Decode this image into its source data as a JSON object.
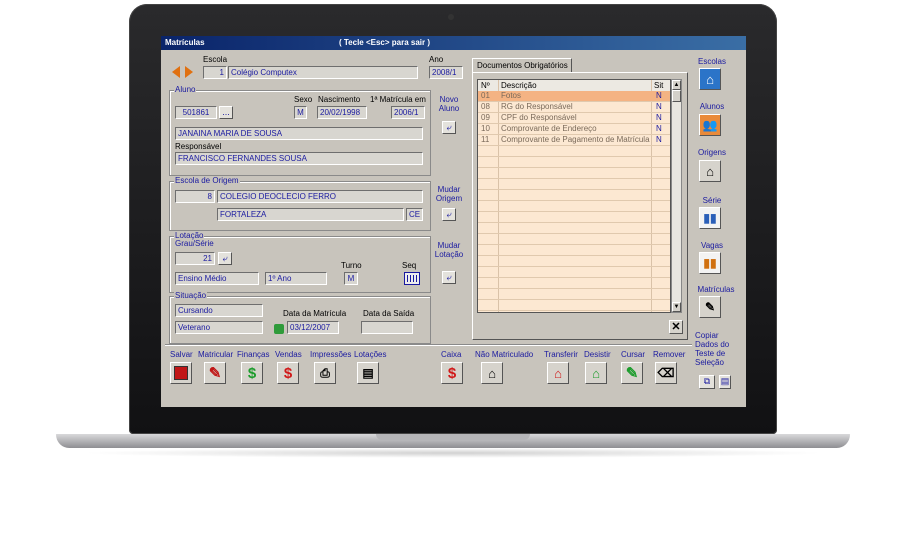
{
  "window": {
    "title": "Matrículas",
    "hint": "( Tecle <Esc> para sair )"
  },
  "escola": {
    "label": "Escola",
    "code": "1",
    "name": "Colégio Computex",
    "ano_label": "Ano",
    "ano": "2008/1"
  },
  "aluno": {
    "group": "Aluno",
    "code": "501861",
    "browse": "...",
    "sexo_label": "Sexo",
    "sexo": "M",
    "nascimento_label": "Nascimento",
    "nascimento": "20/02/1998",
    "primeira_label": "1ª Matrícula em",
    "primeira": "2006/1",
    "nome": "JANAINA MARIA DE SOUSA",
    "responsavel_label": "Responsável",
    "responsavel": "FRANCISCO FERNANDES SOUSA",
    "novo_label": "Novo Aluno"
  },
  "origem": {
    "group": "Escola de Origem",
    "code": "8",
    "name": "COLEGIO DEOCLECIO FERRO",
    "cidade": "FORTALEZA",
    "uf": "CE",
    "mudar_label": "Mudar Origem"
  },
  "lotacao": {
    "group": "Lotação",
    "grau_label": "Grau/Série",
    "grau": "21",
    "nivel": "Ensino Médio",
    "serie": "1º Ano",
    "turno_label": "Turno",
    "turno": "M",
    "seq_label": "Seq",
    "mudar_label": "Mudar Lotação"
  },
  "situacao": {
    "group": "Situação",
    "status": "Cursando",
    "tipo": "Veterano",
    "data_matricula_label": "Data da Matrícula",
    "data_matricula": "03/12/2007",
    "data_saida_label": "Data da Saída",
    "data_saida": ""
  },
  "documentos": {
    "tab": "Documentos Obrigatórios",
    "col_num": "Nº",
    "col_desc": "Descrição",
    "col_sit": "Sit",
    "rows": [
      {
        "num": "01",
        "desc": "Fotos",
        "sit": "N"
      },
      {
        "num": "08",
        "desc": "RG do Responsável",
        "sit": "N"
      },
      {
        "num": "09",
        "desc": "CPF do Responsável",
        "sit": "N"
      },
      {
        "num": "10",
        "desc": "Comprovante de Endereço",
        "sit": "N"
      },
      {
        "num": "11",
        "desc": "Comprovante de Pagamento de Matrícula",
        "sit": "N"
      }
    ]
  },
  "sidebar": {
    "escolas": "Escolas",
    "alunos": "Alunos",
    "origens": "Origens",
    "serie": "Série",
    "vagas": "Vagas",
    "matriculas": "Matrículas",
    "copiar": "Copiar Dados do Teste de Seleção"
  },
  "toolbar": {
    "salvar": "Salvar",
    "matricular": "Matricular",
    "financas": "Finanças",
    "vendas": "Vendas",
    "impressoes": "Impressões",
    "lotacoes": "Lotações",
    "caixa": "Caixa",
    "nao_matriculado": "Não Matriculado",
    "transferir": "Transferir",
    "desistir": "Desistir",
    "cursar": "Cursar",
    "remover": "Remover"
  }
}
